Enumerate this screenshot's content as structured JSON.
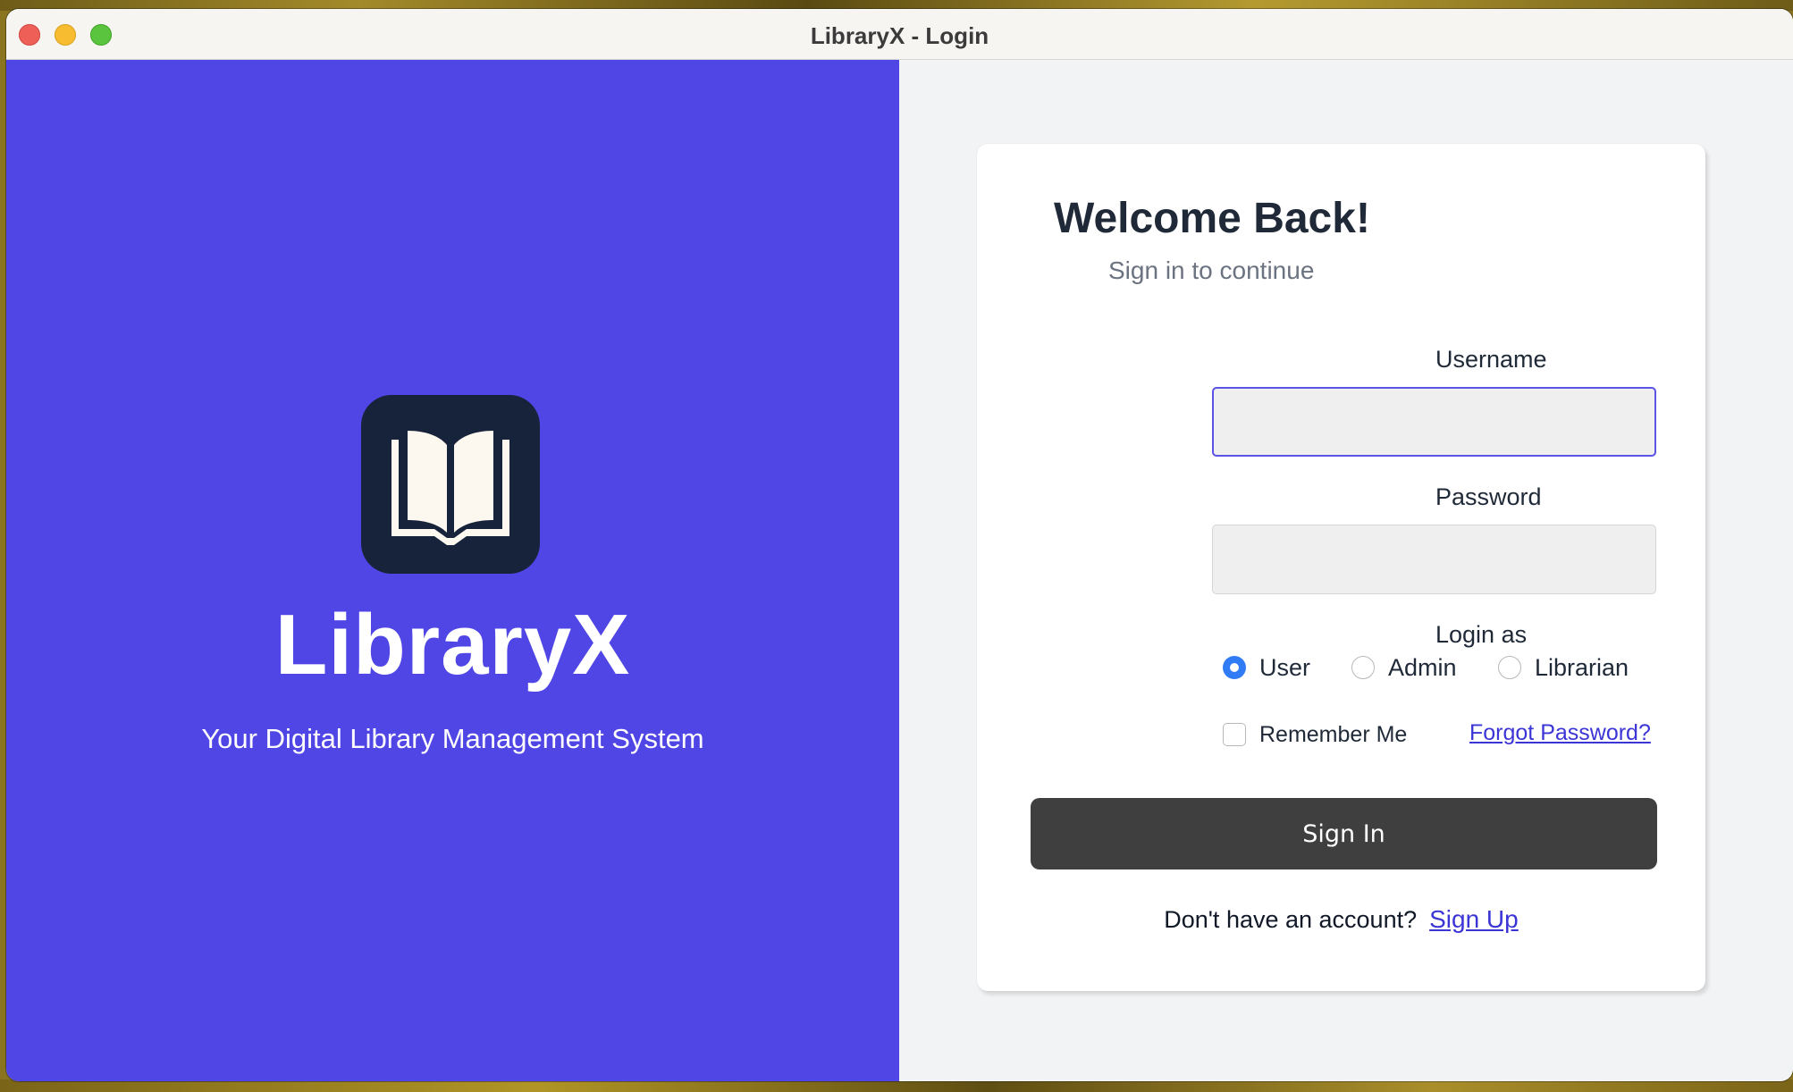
{
  "window": {
    "title": "LibraryX - Login"
  },
  "brand": {
    "logo_icon": "open-book-icon",
    "name": "LibraryX",
    "tagline": "Your Digital Library Management System",
    "panel_color": "#4f46e5",
    "logo_bg_color": "#16233a"
  },
  "login": {
    "heading": "Welcome Back!",
    "subheading": "Sign in to continue",
    "username_label": "Username",
    "username_value": "",
    "password_label": "Password",
    "password_value": "",
    "role_label": "Login as",
    "roles": [
      {
        "label": "User",
        "selected": true
      },
      {
        "label": "Admin",
        "selected": false
      },
      {
        "label": "Librarian",
        "selected": false
      }
    ],
    "remember_label": "Remember Me",
    "remember_checked": false,
    "forgot_label": "Forgot Password?",
    "submit_label": "Sign In",
    "signup_prompt": "Don't have an account?",
    "signup_link": "Sign Up",
    "button_color": "#3f3f3f",
    "link_color": "#3b35d6"
  }
}
